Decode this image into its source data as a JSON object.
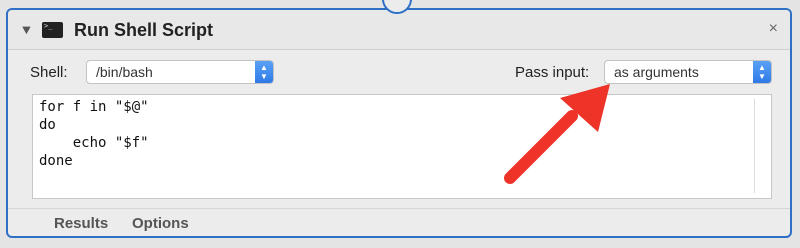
{
  "action": {
    "title": "Run Shell Script",
    "close_glyph": "×",
    "disclosure_glyph": "▼",
    "icon": "terminal-icon"
  },
  "shell": {
    "label": "Shell:",
    "value": "/bin/bash"
  },
  "pass_input": {
    "label": "Pass input:",
    "value": "as arguments"
  },
  "script": {
    "lines": [
      "for f in \"$@\"",
      "do",
      "    echo \"$f\"",
      "done"
    ]
  },
  "footer_tabs": [
    "Results",
    "Options"
  ],
  "colors": {
    "accent": "#2f6fc6",
    "arrow": "#ee3329",
    "stepper": "#3a86ee"
  }
}
